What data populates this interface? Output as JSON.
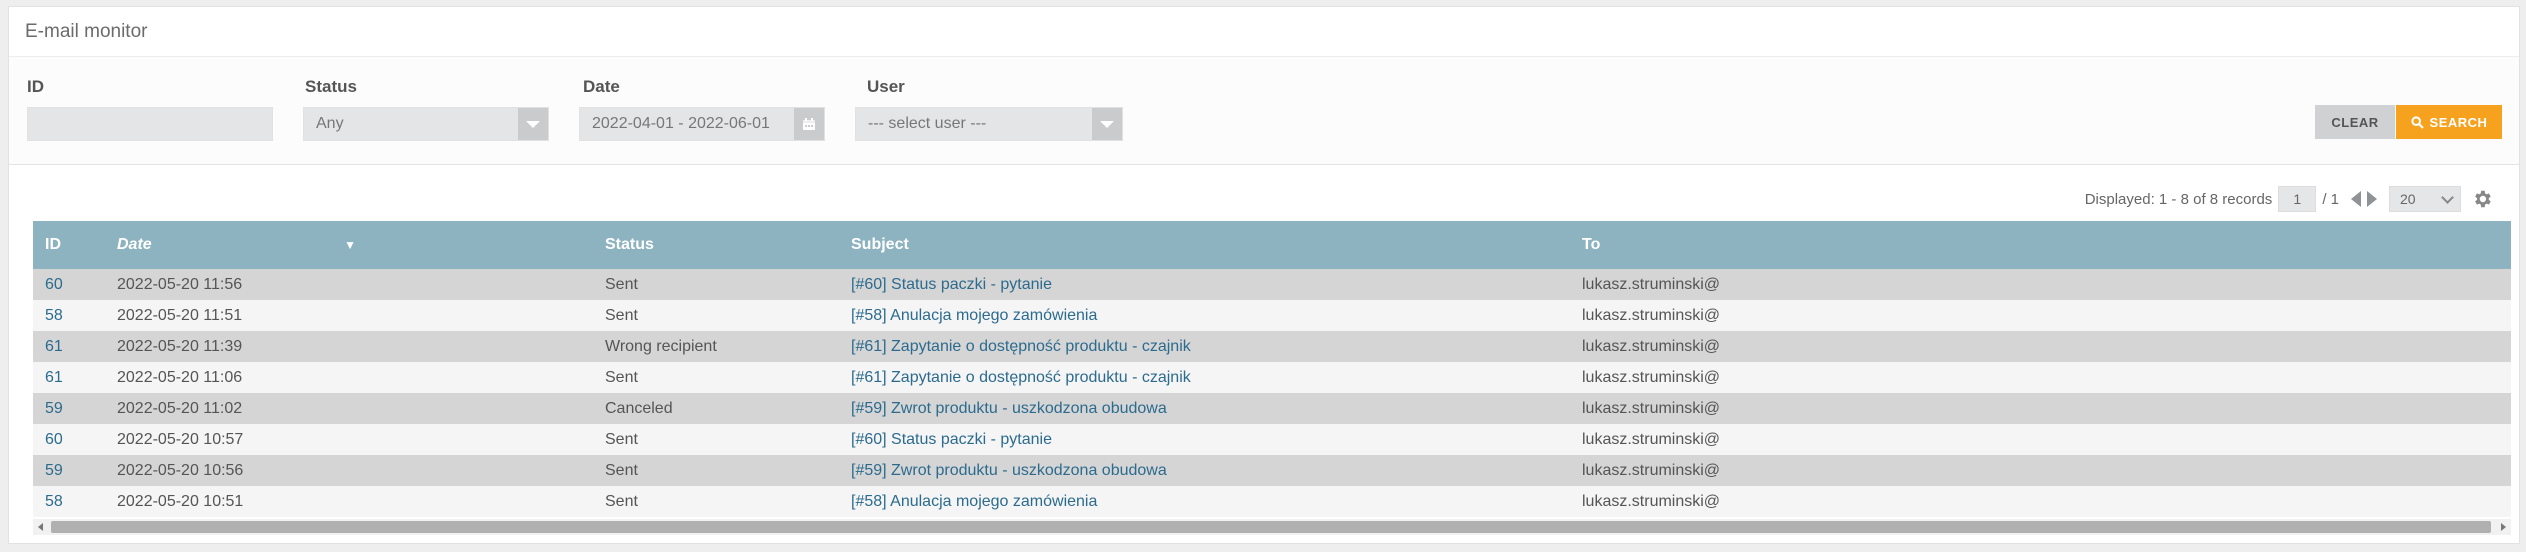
{
  "page": {
    "title": "E-mail monitor"
  },
  "filters": {
    "id": {
      "label": "ID",
      "value": ""
    },
    "status": {
      "label": "Status",
      "value": "Any"
    },
    "date": {
      "label": "Date",
      "value": "2022-04-01 - 2022-06-01"
    },
    "user": {
      "label": "User",
      "value": "--- select user ---"
    }
  },
  "buttons": {
    "clear": "CLEAR",
    "search": "SEARCH"
  },
  "pager": {
    "displayed": "Displayed: 1 - 8 of 8 records",
    "page": "1",
    "total": "/ 1",
    "per_page": "20"
  },
  "colors": {
    "header_bg": "#8db3c1",
    "accent": "#f6a21e",
    "link": "#2c6b8e"
  },
  "table": {
    "headers": [
      "ID",
      "Date",
      "Status",
      "Subject",
      "To"
    ],
    "sort_indicator": "▼",
    "rows": [
      [
        "60",
        "2022-05-20 11:56",
        "Sent",
        "[#60] Status paczki - pytanie",
        "lukasz.struminski@"
      ],
      [
        "58",
        "2022-05-20 11:51",
        "Sent",
        "[#58] Anulacja mojego zamówienia",
        "lukasz.struminski@"
      ],
      [
        "61",
        "2022-05-20 11:39",
        "Wrong recipient",
        "[#61] Zapytanie o dostępność produktu - czajnik",
        "lukasz.struminski@"
      ],
      [
        "61",
        "2022-05-20 11:06",
        "Sent",
        "[#61] Zapytanie o dostępność produktu - czajnik",
        "lukasz.struminski@"
      ],
      [
        "59",
        "2022-05-20 11:02",
        "Canceled",
        "[#59] Zwrot produktu - uszkodzona obudowa",
        "lukasz.struminski@"
      ],
      [
        "60",
        "2022-05-20 10:57",
        "Sent",
        "[#60] Status paczki - pytanie",
        "lukasz.struminski@"
      ],
      [
        "59",
        "2022-05-20 10:56",
        "Sent",
        "[#59] Zwrot produktu - uszkodzona obudowa",
        "lukasz.struminski@"
      ],
      [
        "58",
        "2022-05-20 10:51",
        "Sent",
        "[#58] Anulacja mojego zamówienia",
        "lukasz.struminski@"
      ]
    ]
  }
}
